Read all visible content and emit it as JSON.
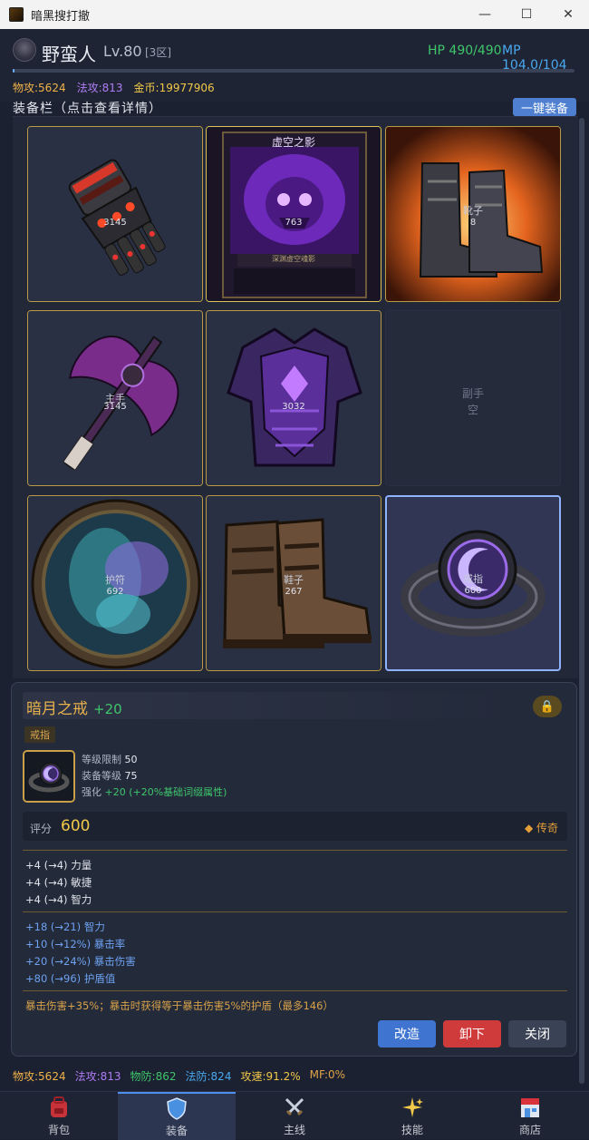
{
  "window": {
    "title": "暗黑搜打撤",
    "minimize": "—",
    "maximize": "☐",
    "close": "✕"
  },
  "character": {
    "name": "野蛮人",
    "level": "Lv.80",
    "zone": "[3区]",
    "hp": "HP 490/490",
    "mp": "MP 104.0/104",
    "xp_fraction": 0.004,
    "stats": {
      "atk": "物攻:5624",
      "mag": "法攻:813",
      "gold": "金币:19977906"
    }
  },
  "equipment": {
    "title": "装备栏（点击查看详情）",
    "one_click": "一键装备",
    "slots": [
      {
        "label": "",
        "score": "3145",
        "art": "gauntlet",
        "state": "equipped"
      },
      {
        "label": "",
        "score": "763",
        "art": "skull-card",
        "state": "equipped",
        "card_title": "虚空之影",
        "card_caption": "深渊虚空魂影"
      },
      {
        "label": "靴子",
        "score": "8",
        "art": "fire-boots",
        "state": "equipped"
      },
      {
        "label": "主手",
        "score": "3145",
        "art": "axe",
        "state": "equipped"
      },
      {
        "label": "",
        "score": "3032",
        "art": "armor",
        "state": "equipped"
      },
      {
        "label": "副手",
        "score": "空",
        "art": "none",
        "state": "empty"
      },
      {
        "label": "护符",
        "score": "692",
        "art": "amulet",
        "state": "equipped"
      },
      {
        "label": "鞋子",
        "score": "267",
        "art": "boots",
        "state": "equipped"
      },
      {
        "label": "戒指",
        "score": "600",
        "art": "ring",
        "state": "selected"
      }
    ]
  },
  "detail": {
    "name": "暗月之戒",
    "enhance": "+20",
    "lock_icon": "lock-icon",
    "type": "戒指",
    "req_level_label": "等级限制",
    "req_level": "50",
    "item_level_label": "装备等级",
    "item_level": "75",
    "enhance_label": "强化",
    "enhance_text": "+20 (+20%基础词缀属性)",
    "score_label": "评分",
    "score": "600",
    "rarity": "◆ 传奇",
    "basic": [
      "+4 (→4) 力量",
      "+4 (→4) 敏捷",
      "+4 (→4) 智力"
    ],
    "affixes": [
      "+18 (→21) 智力",
      "+10 (→12%) 暴击率",
      "+20 (→24%) 暴击伤害",
      "+80 (→96) 护盾值"
    ],
    "special": "暴击伤害+35%；暴击时获得等于暴击伤害5%的护盾（最多146）",
    "buttons": {
      "modify": "改造",
      "unequip": "卸下",
      "close": "关闭"
    }
  },
  "footer_stats": {
    "atk": "物攻:5624",
    "mag": "法攻:813",
    "pdef": "物防:862",
    "mdef": "法防:824",
    "speed": "攻速:91.2%",
    "mf": "MF:0%"
  },
  "tabs": [
    {
      "label": "背包",
      "icon": "backpack-icon"
    },
    {
      "label": "装备",
      "icon": "shield-icon"
    },
    {
      "label": "主线",
      "icon": "crossed-swords-icon"
    },
    {
      "label": "技能",
      "icon": "sparkles-icon"
    },
    {
      "label": "商店",
      "icon": "shop-icon"
    }
  ],
  "colors": {
    "accent": "#4f8ff0",
    "gold": "#f1c84a",
    "hp": "#3fc56b",
    "mp": "#4aa8f0",
    "legendary": "#e39f3a"
  }
}
